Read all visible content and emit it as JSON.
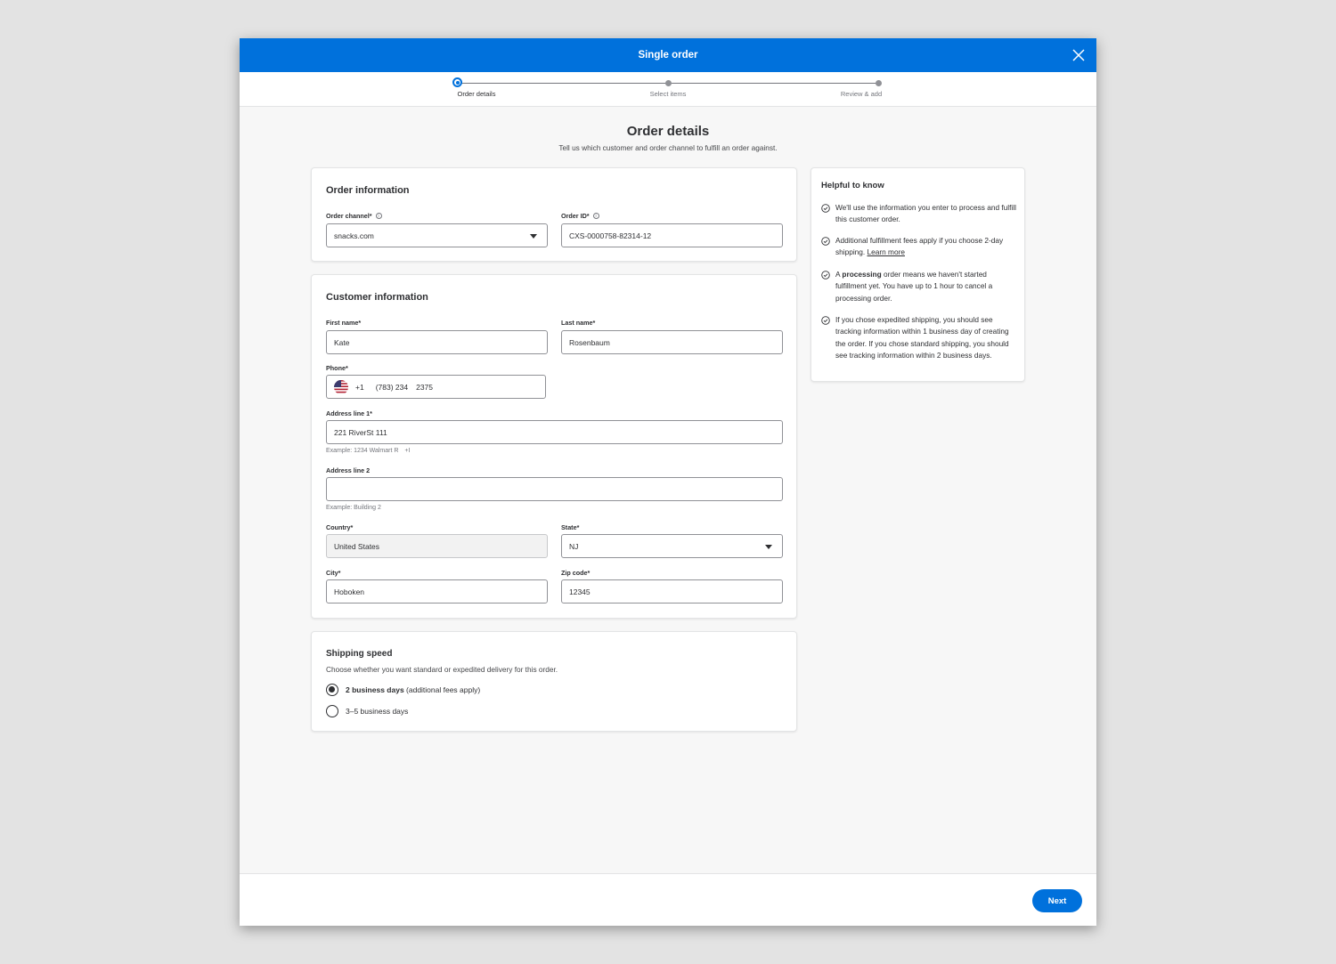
{
  "modal": {
    "title": "Single order"
  },
  "stepper": {
    "steps": [
      {
        "label": "Order details",
        "active": true
      },
      {
        "label": "Select items",
        "active": false
      },
      {
        "label": "Review & add",
        "active": false
      }
    ]
  },
  "page": {
    "title": "Order details",
    "subtitle": "Tell us which customer and order channel to fulfill an order against."
  },
  "order_info": {
    "title": "Order information",
    "channel_label": "Order channel*",
    "channel_value": "snacks.com",
    "order_id_label": "Order ID*",
    "order_id_value": "CXS-0000758-82314-12"
  },
  "customer_info": {
    "title": "Customer information",
    "first_name_label": "First name*",
    "first_name_value": "Kate",
    "last_name_label": "Last name*",
    "last_name_value": "Rosenbaum",
    "phone_label": "Phone*",
    "phone_code": "+1",
    "phone_area": "(783) 234",
    "phone_number": "2375",
    "address1_label": "Address line 1*",
    "address1_value": "221 RiverSt 111",
    "address1_hint": "Example: 1234 Walmart R",
    "address1_hint_suffix": "+I",
    "address2_label": "Address line 2",
    "address2_value": "",
    "address2_hint": "Example: Building 2",
    "country_label": "Country*",
    "country_value": "United States",
    "state_label": "State*",
    "state_value": "NJ",
    "city_label": "City*",
    "city_value": "Hoboken",
    "zip_label": "Zip code*",
    "zip_value": "12345"
  },
  "shipping": {
    "title": "Shipping speed",
    "description": "Choose whether you want standard or expedited delivery for this order.",
    "options": [
      {
        "bold": "2 business days",
        "rest": " (additional fees apply)",
        "checked": true
      },
      {
        "bold": "",
        "rest": "3–5 business days",
        "checked": false
      }
    ]
  },
  "helpful": {
    "title": "Helpful to know",
    "items": [
      {
        "text": "We'll use the information you enter to process and fulfill this customer order."
      },
      {
        "text": "Additional fulfillment fees apply if you choose 2-day shipping. ",
        "link": "Learn more"
      },
      {
        "pre": "A ",
        "bold": "processing",
        "text": " order means we haven't started fulfillment yet. You have up to 1 hour to cancel a processing order."
      },
      {
        "text": "If you chose expedited shipping, you should see tracking information within 1 business day of creating the order. If you chose standard shipping, you should see tracking information within 2 business days."
      }
    ]
  },
  "footer": {
    "next_label": "Next"
  },
  "colors": {
    "primary": "#0071dc",
    "background": "#f7f7f7",
    "text": "#2e2f32"
  },
  "icons": {
    "close": "close-icon",
    "check": "check-circle-icon",
    "info": "info-icon",
    "flag": "us-flag-icon",
    "caret": "caret-down-icon"
  }
}
